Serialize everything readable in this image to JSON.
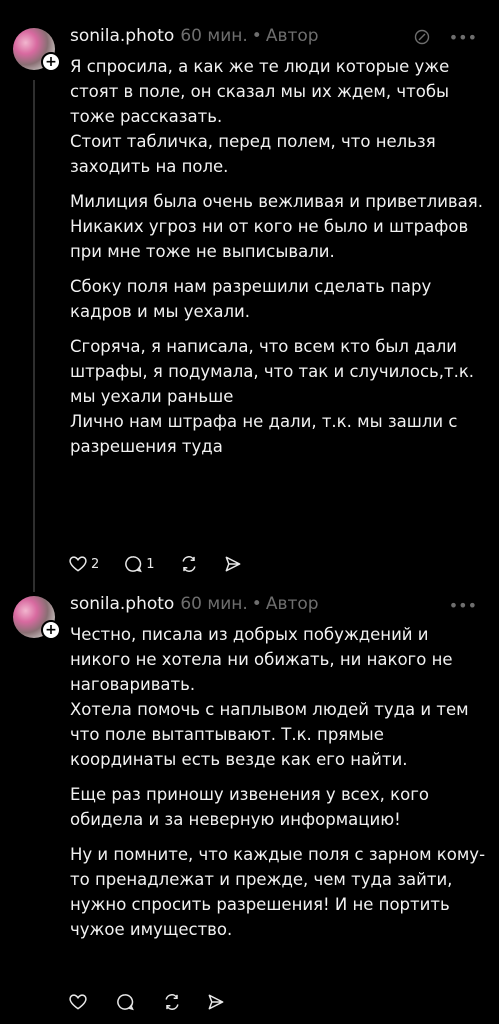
{
  "top_fade_text": "",
  "posts": [
    {
      "username": "sonila.photo",
      "time": "60 мин.",
      "badge": "Автор",
      "paragraphs": [
        "Я спросила, а как же те люди которые уже стоят в поле, он сказал мы их ждем, чтобы тоже рассказать.\nСтоит табличка, перед полем, что нельзя заходить на поле.",
        "Милиция была очень вежливая и приветливая.\nНикаких угроз ни от кого не было и штрафов при мне тоже не выписывали.",
        "Сбоку поля нам разрешили сделать пару кадров и мы уехали.",
        "Сгоряча, я написала, что всем кто был дали штрафы, я подумала, что так и случилось,т.к. мы уехали раньше\nЛично нам штрафа не дали, т.к. мы зашли с разрешения туда"
      ],
      "likes": "2",
      "comments": "1",
      "icons": [
        "heart-icon",
        "comment-icon",
        "repost-icon",
        "share-icon",
        "edit-icon",
        "more-icon"
      ]
    },
    {
      "username": "sonila.photo",
      "time": "60 мин.",
      "badge": "Автор",
      "paragraphs": [
        "Честно, писала из добрых побуждений и никого не хотела ни обижать, ни накого не наговаривать.\nХотела помочь с наплывом людей туда и тем что поле вытаптывают. Т.к. прямые координаты есть везде как его найти.",
        "Еще раз приношу извенения у всех, кого обидела и за неверную информацию!",
        "Ну и помните, что каждые поля с зарном кому-то пренадлежат и прежде, чем туда зайти, нужно спросить разрешения! И не портить чужое имущество."
      ],
      "likes": "",
      "comments": "",
      "icons": [
        "heart-icon",
        "comment-icon",
        "repost-icon",
        "share-icon",
        "more-icon"
      ]
    }
  ]
}
